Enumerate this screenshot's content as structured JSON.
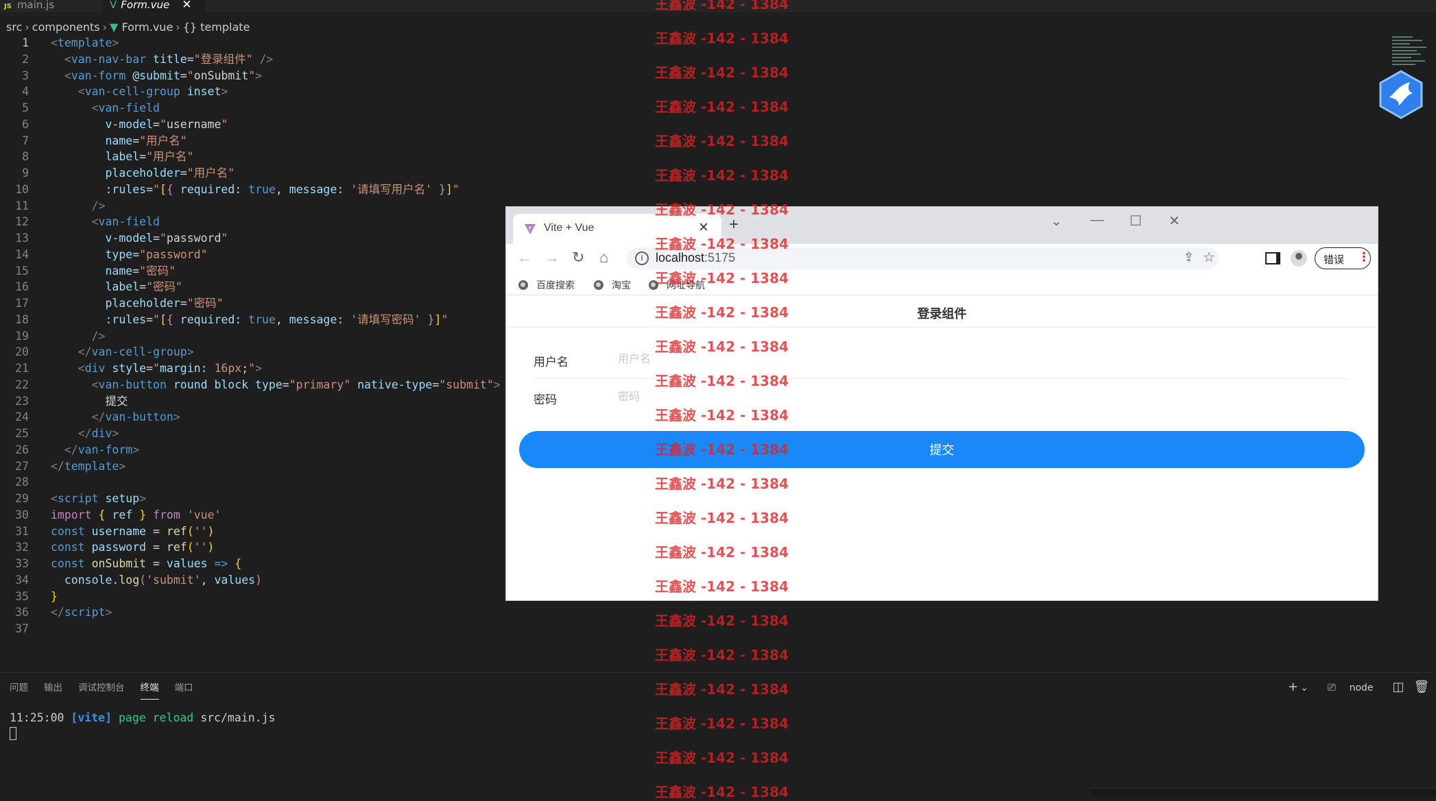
{
  "editor": {
    "tabs": [
      {
        "icon": "JS",
        "label": "main.js"
      },
      {
        "icon": "V",
        "label": "Form.vue"
      }
    ],
    "breadcrumb": [
      "src",
      "components",
      "Form.vue",
      "template"
    ],
    "current_line": 1
  },
  "panel": {
    "tabs": [
      "问题",
      "输出",
      "调试控制台",
      "终端",
      "端口"
    ],
    "active_tab": "终端",
    "terminal_shell": "node",
    "terminal": {
      "time": "11:25:00",
      "tag": "[vite]",
      "msg": "page reload",
      "path": "src/main.js"
    }
  },
  "browser": {
    "tab_title": "Vite + Vue",
    "url_host": "localhost",
    "url_port": ":5175",
    "bookmarks": [
      "百度搜索",
      "淘宝",
      "网址导航"
    ],
    "error_label": "错误",
    "page": {
      "nav_title": "登录组件",
      "fields": [
        {
          "label": "用户名",
          "placeholder": "用户名",
          "value": ""
        },
        {
          "label": "密码",
          "placeholder": "密码",
          "value": ""
        }
      ],
      "submit_label": "提交",
      "button_color": "#1989fa"
    }
  },
  "watermark": {
    "text": "王鑫波 -142 - 1384",
    "color": "#dd2323"
  }
}
